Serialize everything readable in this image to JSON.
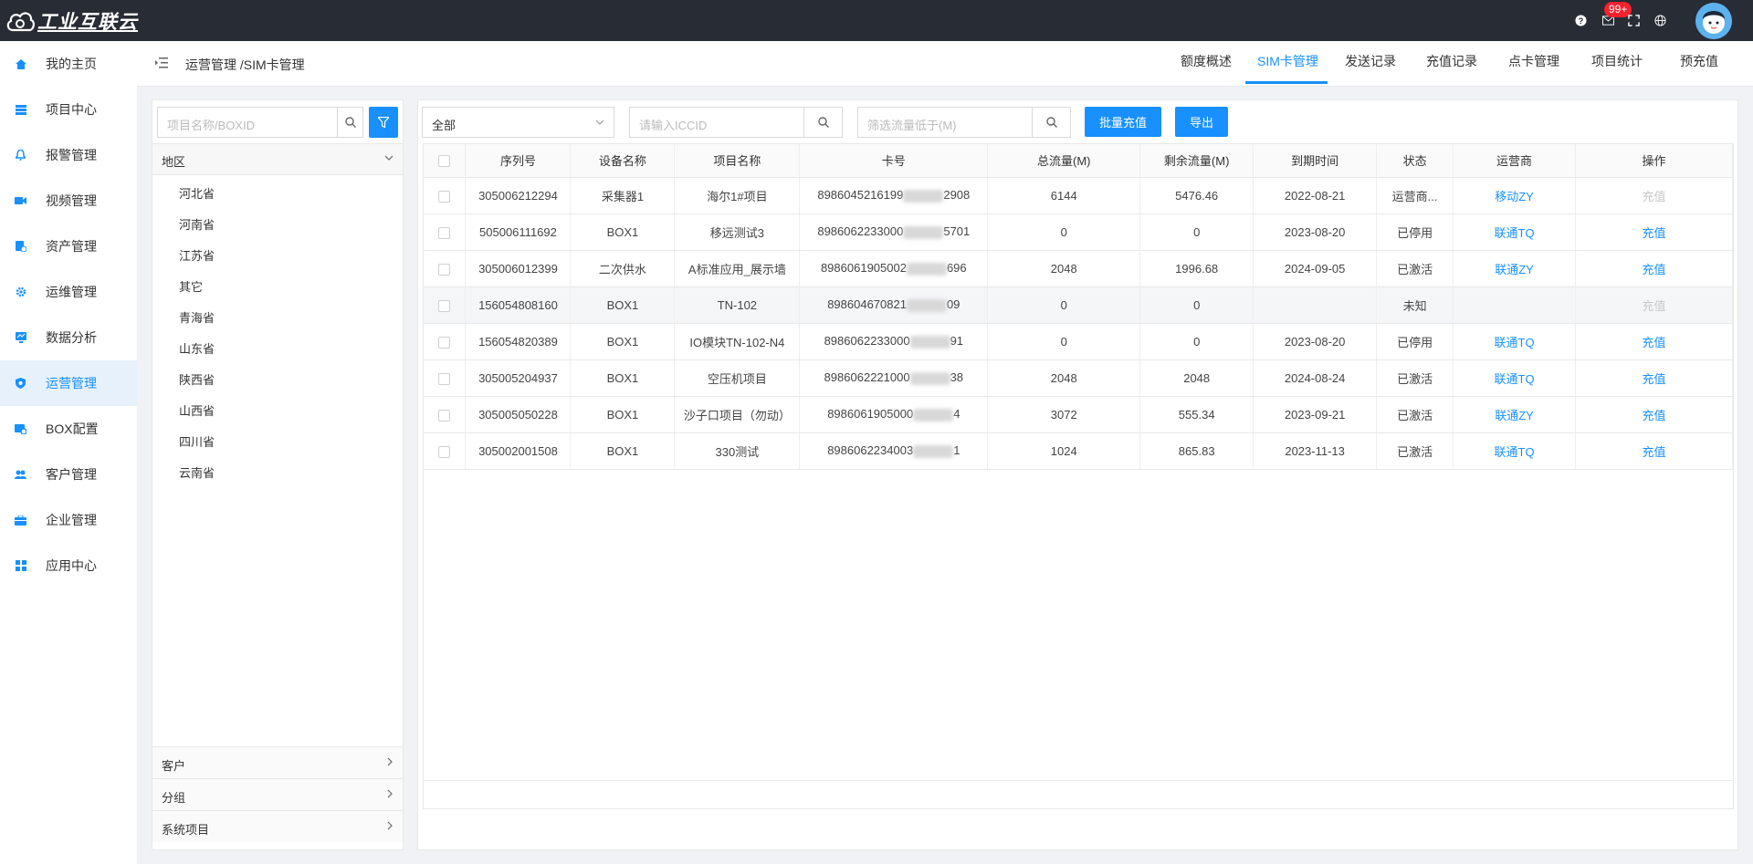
{
  "app": {
    "logo_text": "工业互联云"
  },
  "topbar": {
    "badge": "99+"
  },
  "sidebar": {
    "items": [
      {
        "label": "我的主页",
        "icon": "home-icon"
      },
      {
        "label": "项目中心",
        "icon": "stack-icon"
      },
      {
        "label": "报警管理",
        "icon": "bell-icon"
      },
      {
        "label": "视频管理",
        "icon": "video-icon"
      },
      {
        "label": "资产管理",
        "icon": "asset-icon"
      },
      {
        "label": "运维管理",
        "icon": "gear-icon"
      },
      {
        "label": "数据分析",
        "icon": "monitor-icon"
      },
      {
        "label": "运营管理",
        "icon": "shield-icon"
      },
      {
        "label": "BOX配置",
        "icon": "box-icon"
      },
      {
        "label": "客户管理",
        "icon": "users-icon"
      },
      {
        "label": "企业管理",
        "icon": "briefcase-icon"
      },
      {
        "label": "应用中心",
        "icon": "apps-icon"
      }
    ],
    "active": "运营管理",
    "accent": "#1890ff"
  },
  "header": {
    "breadcrumb": "运营管理 /SIM卡管理",
    "tabs": [
      "额度概述",
      "SIM卡管理",
      "发送记录",
      "充值记录",
      "点卡管理",
      "项目统计",
      "预充值"
    ],
    "active_tab": "SIM卡管理"
  },
  "left": {
    "search_placeholder": "项目名称/BOXID",
    "region_title": "地区",
    "provinces": [
      "河北省",
      "河南省",
      "江苏省",
      "其它",
      "青海省",
      "山东省",
      "陕西省",
      "山西省",
      "四川省",
      "云南省"
    ],
    "groups": [
      "客户",
      "分组",
      "系统项目"
    ]
  },
  "toolbar": {
    "select_value": "全部",
    "iccid_placeholder": "请输入ICCID",
    "flow_placeholder": "筛选流量低于(M)",
    "batch_label": "批量充值",
    "export_label": "导出"
  },
  "table": {
    "columns": [
      "序列号",
      "设备名称",
      "项目名称",
      "卡号",
      "总流量(M)",
      "剩余流量(M)",
      "到期时间",
      "状态",
      "运营商",
      "操作"
    ],
    "rows": [
      {
        "serial": "305006212294",
        "device": "采集器1",
        "project": "海尔1#项目",
        "card_a": "8986045216199",
        "card_b": "2908",
        "total": "6144",
        "remain": "5476.46",
        "expire": "2022-08-21",
        "status": "运营商...",
        "carrier": "移动ZY",
        "op": "充值",
        "op_disabled": true
      },
      {
        "serial": "505006111692",
        "device": "BOX1",
        "project": "移远测试3",
        "card_a": "8986062233000",
        "card_b": "5701",
        "total": "0",
        "remain": "0",
        "expire": "2023-08-20",
        "status": "已停用",
        "carrier": "联通TQ",
        "op": "充值",
        "op_disabled": false
      },
      {
        "serial": "305006012399",
        "device": "二次供水",
        "project": "A标准应用_展示墙",
        "card_a": "8986061905002",
        "card_b": "696",
        "total": "2048",
        "remain": "1996.68",
        "expire": "2024-09-05",
        "status": "已激活",
        "carrier": "联通ZY",
        "op": "充值",
        "op_disabled": false
      },
      {
        "serial": "156054808160",
        "device": "BOX1",
        "project": "TN-102",
        "card_a": "898604670821",
        "card_b": "09",
        "total": "0",
        "remain": "0",
        "expire": "",
        "status": "未知",
        "carrier": "",
        "op": "充值",
        "op_disabled": true
      },
      {
        "serial": "156054820389",
        "device": "BOX1",
        "project": "IO模块TN-102-N4",
        "card_a": "8986062233000",
        "card_b": "91",
        "total": "0",
        "remain": "0",
        "expire": "2023-08-20",
        "status": "已停用",
        "carrier": "联通TQ",
        "op": "充值",
        "op_disabled": false
      },
      {
        "serial": "305005204937",
        "device": "BOX1",
        "project": "空压机项目",
        "card_a": "8986062221000",
        "card_b": "38",
        "total": "2048",
        "remain": "2048",
        "expire": "2024-08-24",
        "status": "已激活",
        "carrier": "联通TQ",
        "op": "充值",
        "op_disabled": false
      },
      {
        "serial": "305005050228",
        "device": "BOX1",
        "project": "沙子口项目（勿动）",
        "card_a": "8986061905000",
        "card_b": "4",
        "total": "3072",
        "remain": "555.34",
        "expire": "2023-09-21",
        "status": "已激活",
        "carrier": "联通ZY",
        "op": "充值",
        "op_disabled": false
      },
      {
        "serial": "305002001508",
        "device": "BOX1",
        "project": "330测试",
        "card_a": "8986062234003",
        "card_b": "1",
        "total": "1024",
        "remain": "865.83",
        "expire": "2023-11-13",
        "status": "已激活",
        "carrier": "联通TQ",
        "op": "充值",
        "op_disabled": false
      }
    ],
    "highlight_row": 3
  }
}
